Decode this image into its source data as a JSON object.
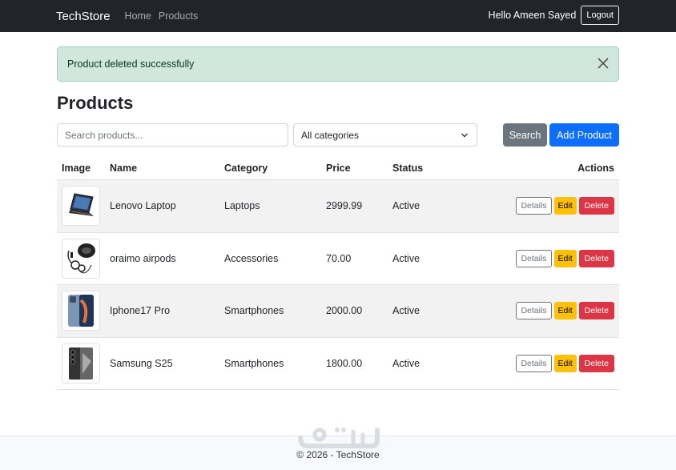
{
  "navbar": {
    "brand": "TechStore",
    "links": [
      "Home",
      "Products"
    ],
    "greeting": "Hello Ameen Sayed",
    "logout_label": "Logout"
  },
  "alert": {
    "message": "Product deleted successfully"
  },
  "page": {
    "title": "Products"
  },
  "filters": {
    "search_placeholder": "Search products...",
    "category_selected": "All categories",
    "search_label": "Search",
    "add_label": "Add Product"
  },
  "table": {
    "headers": [
      "Image",
      "Name",
      "Category",
      "Price",
      "Status",
      "Actions"
    ],
    "rows": [
      {
        "name": "Lenovo Laptop",
        "category": "Laptops",
        "price": "2999.99",
        "status": "Active",
        "image_icon": "laptop-icon"
      },
      {
        "name": "oraimo airpods",
        "category": "Accessories",
        "price": "70.00",
        "status": "Active",
        "image_icon": "earbuds-icon"
      },
      {
        "name": "Iphone17 Pro",
        "category": "Smartphones",
        "price": "2000.00",
        "status": "Active",
        "image_icon": "iphone-icon"
      },
      {
        "name": "Samsung S25",
        "category": "Smartphones",
        "price": "1800.00",
        "status": "Active",
        "image_icon": "samsung-phone-icon"
      }
    ],
    "actions": {
      "details": "Details",
      "edit": "Edit",
      "delete": "Delete"
    }
  },
  "footer": {
    "text": "© 2026 - TechStore"
  },
  "colors": {
    "navbar": "#212529",
    "alert_bg": "#d1e7dd",
    "primary": "#0d6efd",
    "secondary": "#6c757d",
    "warning": "#ffc107",
    "danger": "#dc3545"
  }
}
